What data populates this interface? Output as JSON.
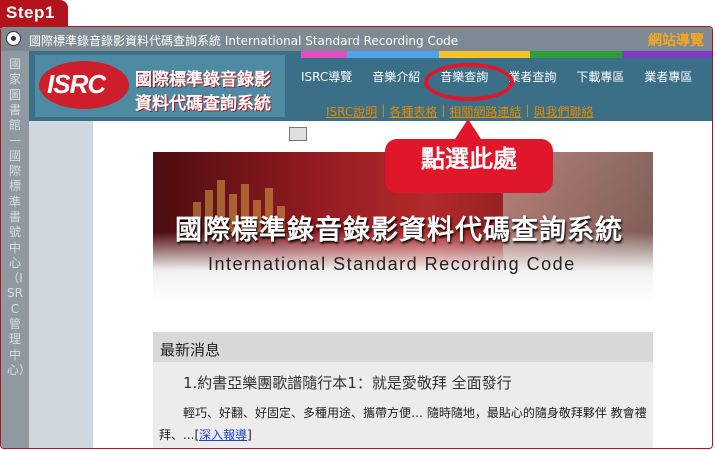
{
  "step_label": "Step1",
  "titlebar": {
    "title": "國際標準錄音錄影資料代碼查詢系統 International Standard Recording Code",
    "sitemap": "網站導覽"
  },
  "side_vertical_text": "國家圖書館—國際標準書號中心（ISRC管理中心）",
  "logo": {
    "mark": "ISRC",
    "line1": "國際標準錄音錄影",
    "line2": "資料代碼查詢系統"
  },
  "color_strip": [
    "#e14ec0",
    "#4fa3e8",
    "#4fa3e8",
    "#f4c430",
    "#f4c430",
    "#2d9d3a",
    "#2d9d3a",
    "#7a3fc2",
    "#7a3fc2"
  ],
  "nav": {
    "items": [
      {
        "label": "ISRC導覽"
      },
      {
        "label": "音樂介紹"
      },
      {
        "label": "音樂查詢"
      },
      {
        "label": "業者查詢"
      },
      {
        "label": "下載專區"
      },
      {
        "label": "業者專區"
      }
    ]
  },
  "subnav": {
    "links": [
      "ISRC說明",
      "各種表格",
      "相關網路連結",
      "與我們聯絡"
    ]
  },
  "callout": {
    "text": "點選此處",
    "color": "#e0162a"
  },
  "hero": {
    "title_zh": "國際標準錄音錄影資料代碼查詢系統",
    "title_en": "International Standard Recording Code"
  },
  "news": {
    "header": "最新消息",
    "item_title": "1.約書亞樂團歌譜隨行本1：就是愛敬拜 全面發行",
    "item_body": "　　輕巧、好翻、好固定、多種用途、攜帶方便… 隨時隨地，最貼心的隨身敬拜夥伴 教會禮拜、...",
    "more_link": "深入報導"
  }
}
